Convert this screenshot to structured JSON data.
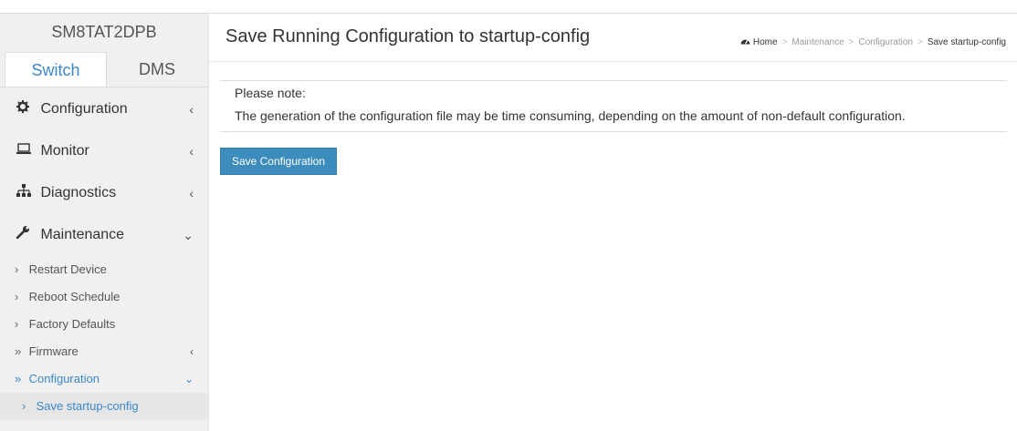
{
  "brand": "SM8TAT2DPB",
  "tabs": [
    {
      "label": "Switch"
    },
    {
      "label": "DMS"
    }
  ],
  "menu": {
    "configuration": {
      "label": "Configuration",
      "chevron": "‹"
    },
    "monitor": {
      "label": "Monitor",
      "chevron": "‹"
    },
    "diagnostics": {
      "label": "Diagnostics",
      "chevron": "‹"
    },
    "maintenance": {
      "label": "Maintenance",
      "chevron": "⌄"
    }
  },
  "submenu": {
    "restart": {
      "mark": "›",
      "label": "Restart Device"
    },
    "reboot": {
      "mark": "›",
      "label": "Reboot Schedule"
    },
    "factory": {
      "mark": "›",
      "label": "Factory Defaults"
    },
    "firmware": {
      "mark": "»",
      "label": "Firmware",
      "chevron": "‹"
    },
    "configuration": {
      "mark": "»",
      "label": "Configuration",
      "chevron": "⌄"
    },
    "save_startup": {
      "mark": "›",
      "label": "Save startup-config"
    }
  },
  "header": {
    "title": "Save Running Configuration to startup-config"
  },
  "breadcrumb": {
    "home": "Home",
    "sep": ">",
    "maintenance": "Maintenance",
    "configuration": "Configuration",
    "current": "Save startup-config"
  },
  "note": {
    "line1": "Please note:",
    "line2": "The generation of the configuration file may be time consuming, depending on the amount of non-default configuration."
  },
  "actions": {
    "save_label": "Save Configuration"
  },
  "colors": {
    "accent": "#3a87c8",
    "button": "#3c8dbc"
  }
}
